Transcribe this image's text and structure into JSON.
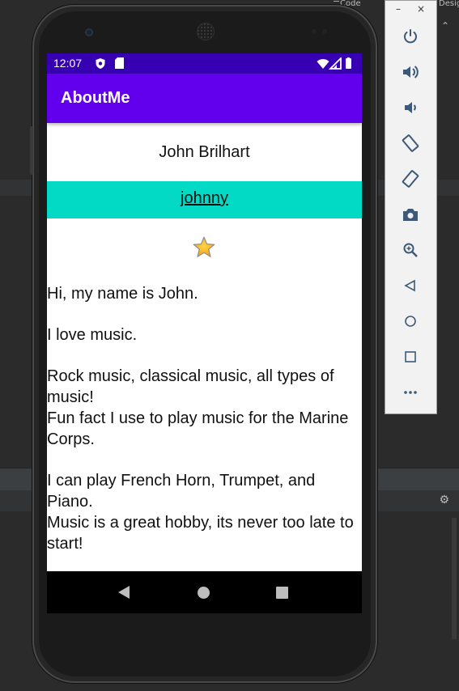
{
  "ide": {
    "tabs": [
      "Code",
      "Desig"
    ]
  },
  "device": {
    "status_bar": {
      "time": "12:07",
      "icons": [
        "shield-icon",
        "sd-card-icon",
        "wifi-icon",
        "cell-signal-icon",
        "battery-icon"
      ]
    },
    "app_bar": {
      "title": "AboutMe"
    },
    "content": {
      "name": "John Brilhart",
      "nickname": "johnny",
      "star_icon": "star-icon",
      "bio_lines": [
        "Hi, my name is John.",
        "",
        "I love music.",
        "",
        "Rock music, classical music, all types of music!",
        "Fun fact I use to play music for the Marine Corps.",
        "",
        "I can play French Horn, Trumpet, and Piano.",
        "Music is a great hobby, its never too late to start!"
      ]
    },
    "nav_bar": {
      "icons": [
        "back-icon",
        "home-icon",
        "recents-icon"
      ]
    }
  },
  "emulator_toolbar": {
    "window_controls": [
      "–",
      "×"
    ],
    "buttons": [
      "power-icon",
      "volume-up-icon",
      "volume-down-icon",
      "rotate-left-icon",
      "rotate-right-icon",
      "camera-icon",
      "zoom-icon",
      "back-icon",
      "home-icon",
      "overview-icon",
      "more-icon"
    ]
  },
  "colors": {
    "status_bar": "#3700b3",
    "app_bar": "#6200ee",
    "nickname_background": "#03dac5",
    "ide_background": "#2b2b2b"
  }
}
